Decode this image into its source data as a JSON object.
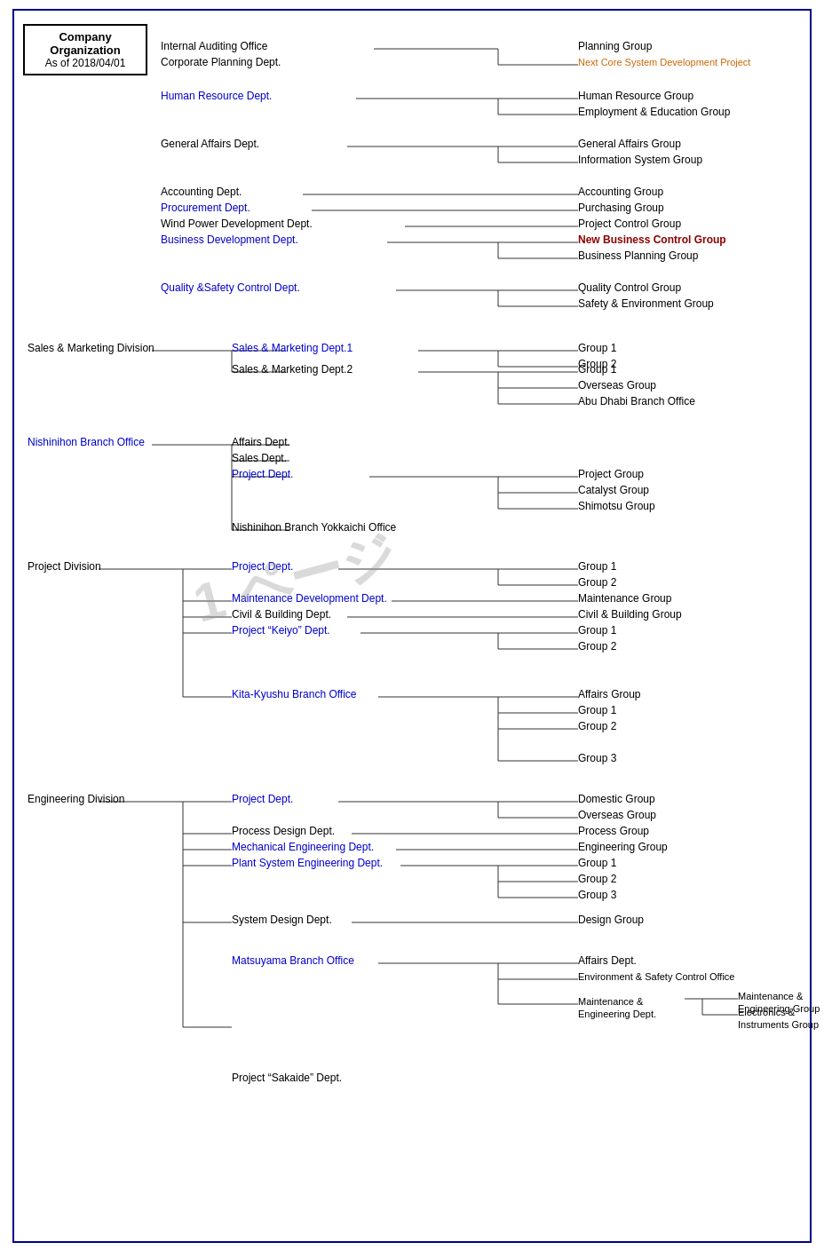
{
  "title": "Company Organization",
  "date": "As of 2018/04/01",
  "watermark": "1 ページ",
  "nodes": {
    "header_dept": [
      {
        "id": "internal_auditing",
        "label": "Internal Auditing Office",
        "color": "black"
      },
      {
        "id": "corporate_planning",
        "label": "Corporate Planning Dept.",
        "color": "black"
      },
      {
        "id": "planning_group",
        "label": "Planning Group",
        "color": "black"
      },
      {
        "id": "next_core",
        "label": "Next Core System Development Project",
        "color": "#CC6600"
      },
      {
        "id": "human_resource_dept",
        "label": "Human Resource Dept.",
        "color": "#0000CD"
      },
      {
        "id": "human_resource_group",
        "label": "Human Resource Group",
        "color": "black"
      },
      {
        "id": "employment_education",
        "label": "Employment & Education Group",
        "color": "black"
      },
      {
        "id": "general_affairs_dept",
        "label": "General Affairs Dept.",
        "color": "black"
      },
      {
        "id": "general_affairs_group",
        "label": "General Affairs Group",
        "color": "black"
      },
      {
        "id": "info_system_group",
        "label": "Information System Group",
        "color": "black"
      },
      {
        "id": "accounting_dept",
        "label": "Accounting Dept.",
        "color": "black"
      },
      {
        "id": "accounting_group",
        "label": "Accounting Group",
        "color": "black"
      },
      {
        "id": "procurement_dept",
        "label": "Procurement Dept.",
        "color": "#0000CD"
      },
      {
        "id": "purchasing_group",
        "label": "Purchasing Group",
        "color": "black"
      },
      {
        "id": "wind_power_dept",
        "label": "Wind Power Development Dept.",
        "color": "black"
      },
      {
        "id": "project_control_group",
        "label": "Project Control Group",
        "color": "black"
      },
      {
        "id": "business_dev_dept",
        "label": "Business Development Dept.",
        "color": "#0000CD"
      },
      {
        "id": "new_business_control",
        "label": "New Business Control Group",
        "color": "#8B0000"
      },
      {
        "id": "business_planning",
        "label": "Business Planning Group",
        "color": "black"
      },
      {
        "id": "quality_safety_dept",
        "label": "Quality &Safety Control Dept.",
        "color": "#0000CD"
      },
      {
        "id": "quality_control_group",
        "label": "Quality Control Group",
        "color": "black"
      },
      {
        "id": "safety_env_group",
        "label": "Safety & Environment Group",
        "color": "black"
      }
    ],
    "sales_division": {
      "label": "Sales & Marketing Division",
      "color": "black",
      "departments": [
        {
          "label": "Sales & Marketing Dept.1",
          "color": "#0000CD",
          "groups": [
            "Group 1",
            "Group 2"
          ]
        },
        {
          "label": "Sales & Marketing Dept.2",
          "color": "black",
          "groups": [
            "Group 1",
            "Overseas Group",
            "Abu Dhabi Branch Office"
          ]
        }
      ]
    },
    "nishinihon": {
      "label": "Nishinihon Branch Office",
      "color": "#0000CD",
      "departments": [
        {
          "label": "Affairs Dept.",
          "color": "black",
          "groups": []
        },
        {
          "label": "Sales Dept.",
          "color": "black",
          "groups": []
        },
        {
          "label": "Project Dept.",
          "color": "#0000CD",
          "groups": [
            "Project Group",
            "Catalyst Group",
            "Shimotsu Group"
          ]
        },
        {
          "label": "Nishinihon Branch Yokkaichi Office",
          "color": "black",
          "groups": []
        }
      ]
    },
    "project_division": {
      "label": "Project Division",
      "color": "black",
      "departments": [
        {
          "label": "Project Dept.",
          "color": "#0000CD",
          "groups": [
            "Group 1",
            "Group 2"
          ]
        },
        {
          "label": "Maintenance Development Dept.",
          "color": "#0000CD",
          "groups": [
            "Maintenance Group"
          ]
        },
        {
          "label": "Civil & Building Dept.",
          "color": "black",
          "groups": [
            "Civil & Building Group"
          ]
        },
        {
          "label": "Project “Keiyo” Dept.",
          "color": "#0000CD",
          "groups": [
            "Group 1",
            "Group 2"
          ]
        },
        {
          "label": "Kita-Kyushu Branch Office",
          "color": "#0000CD",
          "groups": [
            "Affairs Group",
            "Group 1",
            "Group 2",
            "Group 3"
          ]
        }
      ]
    },
    "engineering_division": {
      "label": "Engineering Division",
      "color": "black",
      "departments": [
        {
          "label": "Project Dept.",
          "color": "#0000CD",
          "groups": [
            "Domestic Group",
            "Overseas Group"
          ]
        },
        {
          "label": "Process Design Dept.",
          "color": "black",
          "groups": [
            "Process Group"
          ]
        },
        {
          "label": "Mechanical Engineering Dept.",
          "color": "#0000CD",
          "groups": [
            "Engineering Group"
          ]
        },
        {
          "label": "Plant System Engineering Dept.",
          "color": "#0000CD",
          "groups": [
            "Group 1",
            "Group 2",
            "Group 3"
          ]
        },
        {
          "label": "System Design Dept.",
          "color": "black",
          "groups": [
            "Design Group"
          ]
        },
        {
          "label": "Matsuyama Branch Office",
          "color": "#0000CD",
          "sub": {
            "single": "Affairs Dept.",
            "branch": [
              "Environment & Safety Control Office"
            ],
            "sub2": {
              "label": "Maintenance & Engineering Dept.",
              "groups": [
                "Maintenance & Engineering Group",
                "Electronics & Instruments Group"
              ]
            }
          }
        },
        {
          "label": "Project “Sakaide” Dept.",
          "color": "black",
          "groups": []
        }
      ]
    }
  }
}
